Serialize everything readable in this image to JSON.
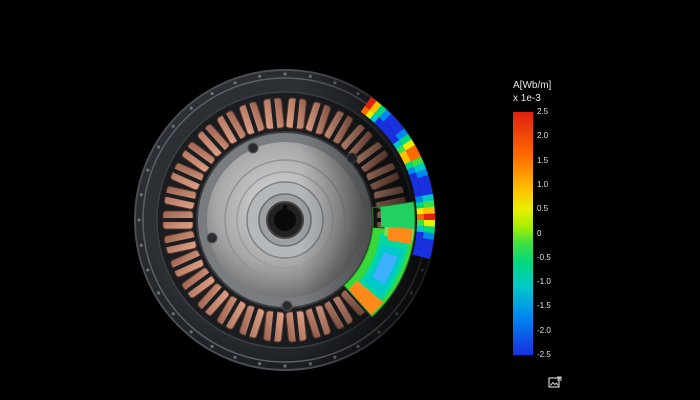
{
  "colorbar": {
    "quantity": "A[Wb/m]",
    "scale_factor": "x 1e-3",
    "ticks": [
      "2.5",
      "2.0",
      "1.5",
      "1.0",
      "0.5",
      "0",
      "-0.5",
      "-1.0",
      "-1.5",
      "-2.0",
      "-2.5"
    ],
    "max": 2.5,
    "min": -2.5
  },
  "icons": {
    "corner": "image-export-icon"
  },
  "colors": {
    "background": "#000000",
    "field_high": "#e02010",
    "field_low": "#1830e0",
    "copper": "#c98b72"
  }
}
